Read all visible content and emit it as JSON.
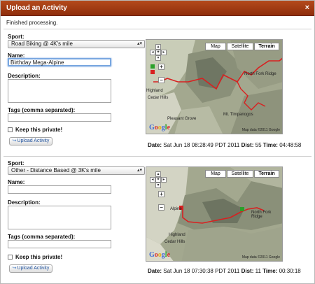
{
  "dialog": {
    "title": "Upload an Activity",
    "close_glyph": "×"
  },
  "status": "Finished processing.",
  "icons": {
    "close": "close-icon",
    "upload": "upload-arrow-icon",
    "select_arrow": "chevron-updown-icon"
  },
  "activities": [
    {
      "sport_label": "Sport:",
      "sport_value": "Road Biking @ 4K's mile",
      "name_label": "Name:",
      "name_value": "Birthday Mega-Alpine",
      "description_label": "Description:",
      "tags_label": "Tags (comma separated):",
      "private_label": "Keep this private!",
      "upload_label": "Upload Activity",
      "map": {
        "map_btn": "Map",
        "satellite_btn": "Satellite",
        "terrain_btn": "Terrain",
        "labels": [
          "Highland",
          "Cedar Hills",
          "North Fork Ridge",
          "Mt. Timpanogos",
          "Pleasant Grove"
        ],
        "google": "Google",
        "copyright": "Map data ©2011 Google"
      },
      "date_label": "Date:",
      "date_value": "Sat Jun 18 08:28:49 PDT 2011",
      "dist_label": "Dist:",
      "dist_value": "55",
      "time_label": "Time:",
      "time_value": "04:48:58"
    },
    {
      "sport_label": "Sport:",
      "sport_value": "Other - Distance Based @ 3K's mile",
      "name_label": "Name:",
      "name_value": "",
      "description_label": "Description:",
      "tags_label": "Tags (comma separated):",
      "private_label": "Keep this private!",
      "upload_label": "Upload Activity",
      "map": {
        "map_btn": "Map",
        "satellite_btn": "Satellite",
        "terrain_btn": "Terrain",
        "labels": [
          "Alpine",
          "Highland",
          "Cedar Hills",
          "North Fork Ridge"
        ],
        "google": "Google",
        "copyright": "Map data ©2011 Google"
      },
      "date_label": "Date:",
      "date_value": "Sat Jun 18 07:30:38 PDT 2011",
      "dist_label": "Dist:",
      "dist_value": "11",
      "time_label": "Time:",
      "time_value": "00:30:18"
    }
  ]
}
